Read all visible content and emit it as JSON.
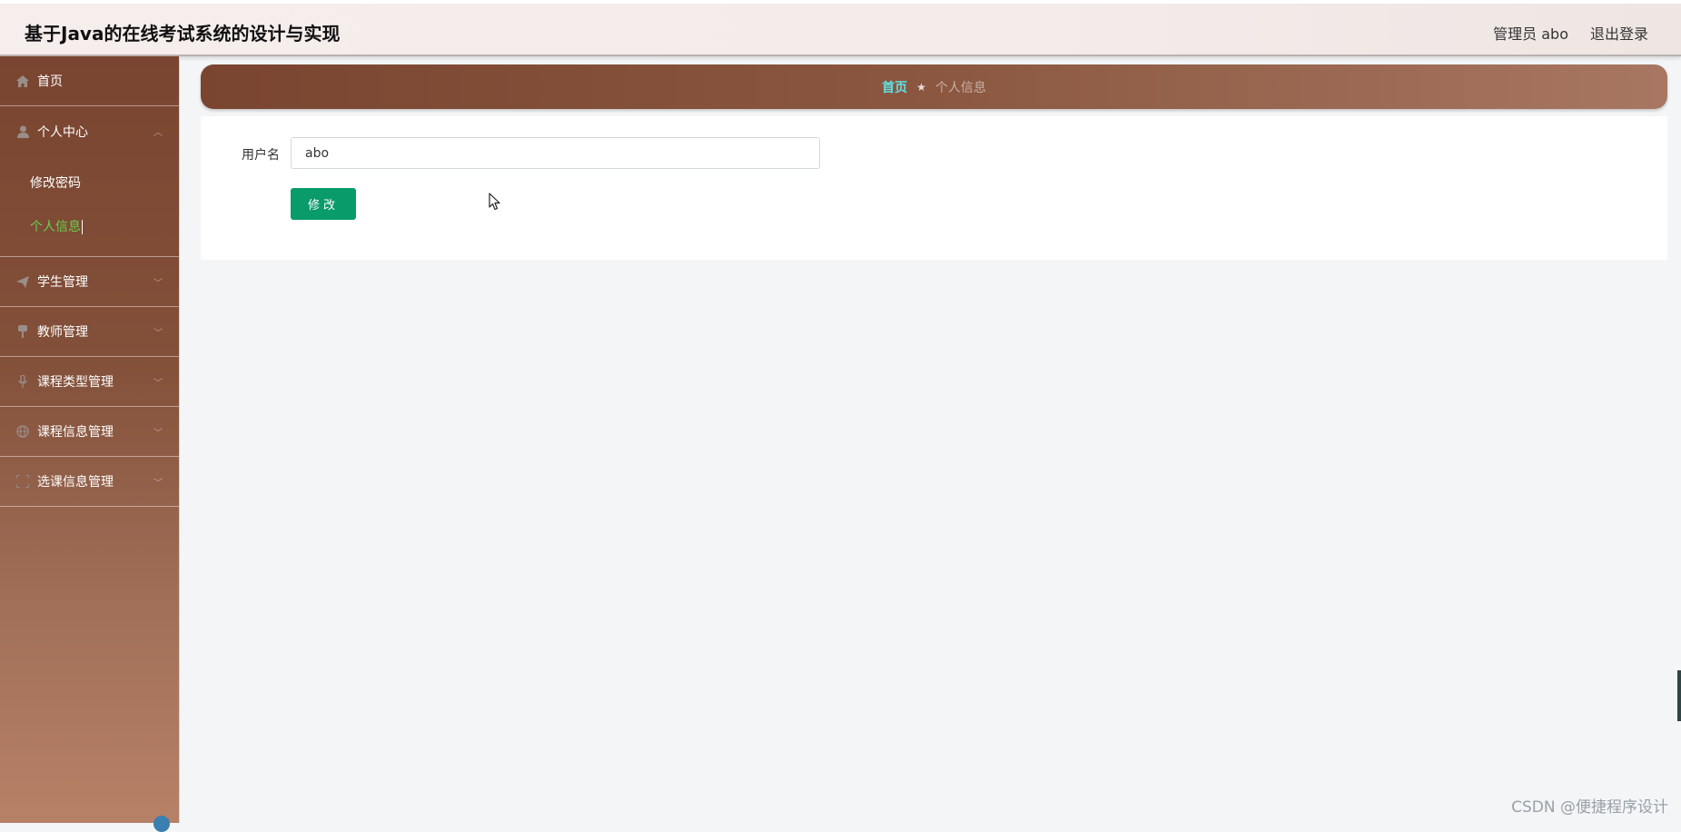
{
  "app": {
    "title": "基于Java的在线考试系统的设计与实现"
  },
  "topbar": {
    "user_label": "管理员 abo",
    "logout_label": "退出登录"
  },
  "sidebar": {
    "items": [
      {
        "label": "首页",
        "icon": "home-icon"
      },
      {
        "label": "个人中心",
        "icon": "user-icon",
        "expanded": true,
        "children": [
          {
            "label": "修改密码"
          },
          {
            "label": "个人信息",
            "active": true
          }
        ]
      },
      {
        "label": "学生管理",
        "icon": "send-icon"
      },
      {
        "label": "教师管理",
        "icon": "pin-icon"
      },
      {
        "label": "课程类型管理",
        "icon": "microphone-icon"
      },
      {
        "label": "课程信息管理",
        "icon": "globe-icon"
      },
      {
        "label": "选课信息管理",
        "icon": "fullscreen-icon"
      }
    ]
  },
  "breadcrumb": {
    "home": "首页",
    "current": "个人信息"
  },
  "form": {
    "username_label": "用户名",
    "username_value": "abo",
    "submit_label": "修改"
  },
  "watermark": "CSDN @便捷程序设计",
  "colors": {
    "accent_green": "#0a9b6b",
    "active_menu": "#66d04a",
    "breadcrumb_home": "#5fe1e4",
    "sidebar_brown": "#7a4530"
  }
}
